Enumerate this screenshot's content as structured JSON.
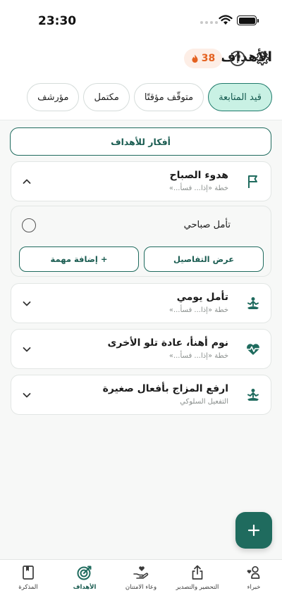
{
  "status_bar": {
    "time": "23:30"
  },
  "header": {
    "title": "الأهداف",
    "streak_count": "38"
  },
  "filters": [
    {
      "label": "قيد المتابعة",
      "active": true
    },
    {
      "label": "متوقّف مؤقتًا",
      "active": false
    },
    {
      "label": "مكتمل",
      "active": false
    },
    {
      "label": "مؤرشف",
      "active": false
    }
  ],
  "ideas_button": "أفكار للأهداف",
  "goals": [
    {
      "title": "هدوء الصباح",
      "subtitle": "خطة «إذا... فسأ...»",
      "icon": "flag-icon",
      "expanded": true
    },
    {
      "title": "تأمل يومي",
      "subtitle": "خطة «إذا... فسأ...»",
      "icon": "meditation-icon",
      "expanded": false
    },
    {
      "title": "نوم أهنأ، عادة تلو الأخرى",
      "subtitle": "خطة «إذا... فسأ...»",
      "icon": "heart-pulse-icon",
      "expanded": false
    },
    {
      "title": "ارفع المزاج بأفعال صغيرة",
      "subtitle": "التفعيل السلوكي",
      "icon": "meditation-icon",
      "expanded": false
    }
  ],
  "expanded_goal": {
    "task": "تأمل صباحي",
    "details_button": "عرض التفاصيل",
    "add_task_button": "+ إضافة مهمة"
  },
  "bottom_nav": [
    {
      "label": "خبراء",
      "icon": "experts-icon"
    },
    {
      "label": "التحضير والتصدير",
      "icon": "share-export-icon"
    },
    {
      "label": "وعاء الامتنان",
      "icon": "gratitude-jar-icon"
    },
    {
      "label": "الأهداف",
      "icon": "target-icon",
      "active": true
    },
    {
      "label": "المذكرة",
      "icon": "notebook-icon"
    }
  ],
  "colors": {
    "accent": "#1f6b5e",
    "accent_light": "#c9f1e4",
    "streak": "#e4611f"
  }
}
